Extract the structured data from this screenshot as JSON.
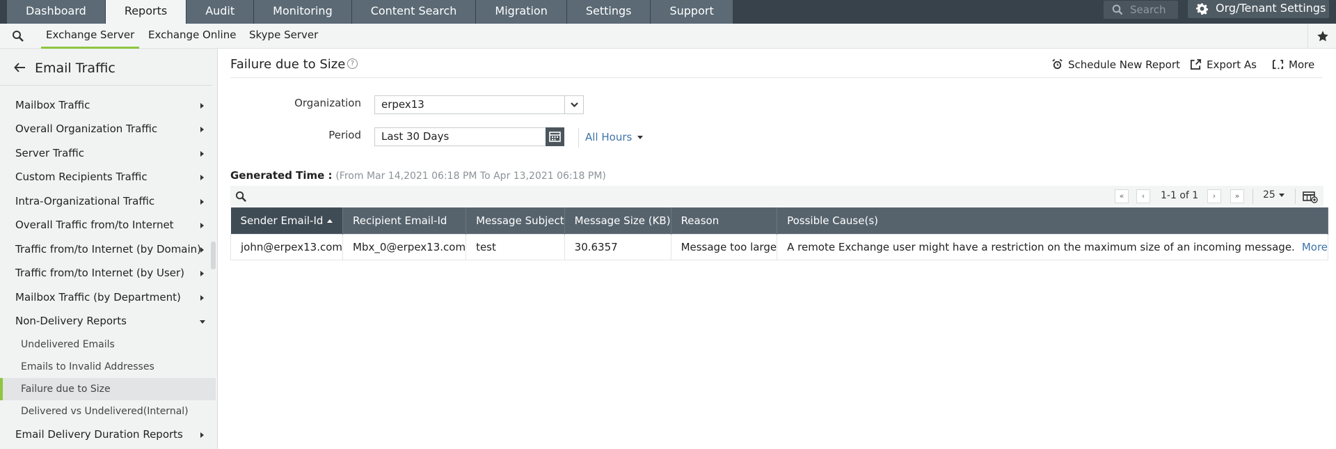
{
  "top_tabs": [
    "Dashboard",
    "Reports",
    "Audit",
    "Monitoring",
    "Content Search",
    "Migration",
    "Settings",
    "Support"
  ],
  "top_search_placeholder": "Search",
  "org_settings_label": "Org/Tenant Settings",
  "sub_tabs": [
    "Exchange Server",
    "Exchange Online",
    "Skype Server"
  ],
  "sidebar": {
    "title": "Email Traffic",
    "items": [
      "Mailbox Traffic",
      "Overall Organization Traffic",
      "Server Traffic",
      "Custom Recipients Traffic",
      "Intra-Organizational Traffic",
      "Overall Traffic from/to Internet",
      "Traffic from/to Internet (by Domain)",
      "Traffic from/to Internet (by User)",
      "Mailbox Traffic (by Department)",
      "Non-Delivery Reports"
    ],
    "subitems": [
      "Undelivered Emails",
      "Emails to Invalid Addresses",
      "Failure due to Size",
      "Delivered vs Undelivered(Internal)"
    ],
    "last_item": "Email Delivery Duration Reports"
  },
  "header": {
    "title": "Failure due to Size",
    "help": "?",
    "schedule": "Schedule New Report",
    "export": "Export As",
    "more": "More"
  },
  "filters": {
    "org_label": "Organization",
    "org_value": "erpex13",
    "period_label": "Period",
    "period_value": "Last 30 Days",
    "hours": "All Hours"
  },
  "generated": {
    "label": "Generated Time :",
    "range": "(From Mar 14,2021 06:18 PM To Apr 13,2021 06:18 PM)"
  },
  "pager": {
    "text": "1-1 of 1",
    "page_size": "25"
  },
  "table": {
    "columns": [
      "Sender Email-Id",
      "Recipient Email-Id",
      "Message Subject",
      "Message Size (KB)",
      "Reason",
      "Possible Cause(s)"
    ],
    "rows": [
      [
        "john@erpex13.com",
        "Mbx_0@erpex13.com",
        "test",
        "30.6357",
        "Message too large",
        "A remote Exchange user might have a restriction on the maximum size of an incoming message."
      ]
    ],
    "more_link": "More"
  },
  "colors": {
    "topbar": "#37424a",
    "tab": "#5b6a75",
    "accent": "#8dc63f",
    "link": "#3d73a9",
    "table_header": "#56636d"
  }
}
